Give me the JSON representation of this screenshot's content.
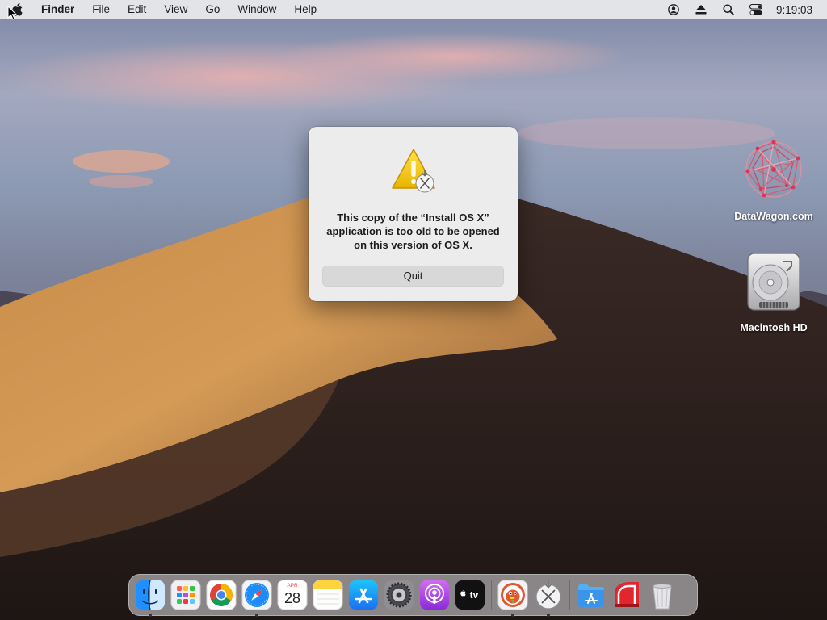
{
  "menubar": {
    "app_name": "Finder",
    "menus": [
      "File",
      "Edit",
      "View",
      "Go",
      "Window",
      "Help"
    ],
    "clock": "9:19:03",
    "status_icons": [
      "user-icon",
      "eject-icon",
      "search-icon",
      "control-center-icon"
    ]
  },
  "alert": {
    "message": "This copy of the “Install OS X” application is too old to be opened on this version of OS X.",
    "quit_label": "Quit",
    "icon": "warning-installer-icon"
  },
  "desktop_icons": [
    {
      "label": "DataWagon.com",
      "icon": "datawagon-icon"
    },
    {
      "label": "Macintosh HD",
      "icon": "hard-drive-icon"
    }
  ],
  "dock": {
    "apps": [
      {
        "name": "Finder",
        "icon": "finder-icon",
        "running": true
      },
      {
        "name": "Launchpad",
        "icon": "launchpad-icon",
        "running": false
      },
      {
        "name": "Chrome",
        "icon": "chrome-icon",
        "running": false
      },
      {
        "name": "Safari",
        "icon": "safari-icon",
        "running": true
      },
      {
        "name": "Calendar",
        "icon": "calendar-icon",
        "running": false,
        "month": "APR",
        "day": "28"
      },
      {
        "name": "Notes",
        "icon": "notes-icon",
        "running": false
      },
      {
        "name": "App Store",
        "icon": "app-store-icon",
        "running": false
      },
      {
        "name": "System Preferences",
        "icon": "system-preferences-icon",
        "running": false
      },
      {
        "name": "Podcasts",
        "icon": "podcasts-icon",
        "running": false
      },
      {
        "name": "TV",
        "icon": "apple-tv-icon",
        "running": false,
        "text": "tv"
      },
      {
        "name": "DuckDuckGo",
        "icon": "duckduckgo-icon",
        "running": true
      },
      {
        "name": "Install OS X",
        "icon": "install-os-x-icon",
        "running": true
      },
      {
        "name": "Applications",
        "icon": "applications-folder-icon",
        "running": false
      },
      {
        "name": "Drop",
        "icon": "red-app-icon",
        "running": false
      },
      {
        "name": "Trash",
        "icon": "trash-icon",
        "running": false
      }
    ]
  },
  "colors": {
    "menubar_bg": "#ebebee",
    "alert_bg": "#ececec",
    "button_bg": "#d8d8d8"
  }
}
